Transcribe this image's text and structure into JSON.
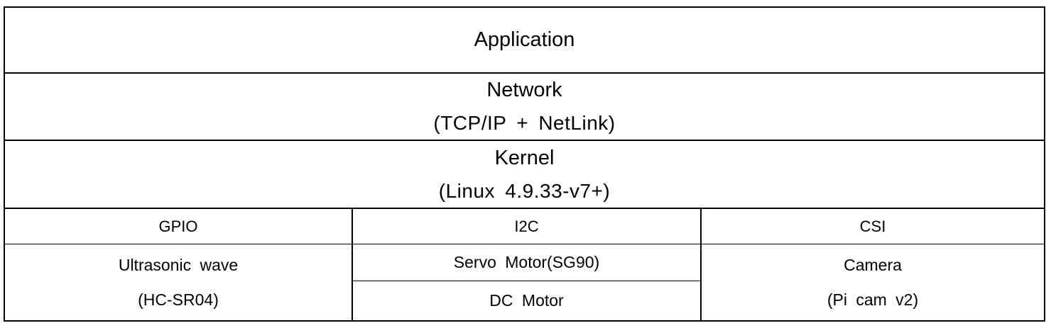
{
  "layers": {
    "application": {
      "title": "Application"
    },
    "network": {
      "title": "Network",
      "detail": "(TCP/IP + NetLink)"
    },
    "kernel": {
      "title": "Kernel",
      "detail": "(Linux 4.9.33-v7+)"
    }
  },
  "interfaces": {
    "gpio": {
      "header": "GPIO",
      "device_line1": "Ultrasonic wave",
      "device_line2": "(HC-SR04)"
    },
    "i2c": {
      "header": "I2C",
      "device_a": "Servo Motor(SG90)",
      "device_b": "DC Motor"
    },
    "csi": {
      "header": "CSI",
      "device_line1": "Camera",
      "device_line2": "(Pi cam v2)"
    }
  }
}
